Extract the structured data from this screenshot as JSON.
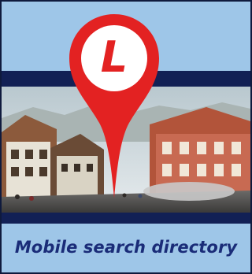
{
  "logo": {
    "letter": "L",
    "pin_color": "#e32222",
    "icon": "map-pin-icon"
  },
  "caption": {
    "text": "Mobile search directory"
  },
  "colors": {
    "sky": "#9ec6e8",
    "band": "#122055",
    "caption_text": "#1a2c78"
  },
  "photo": {
    "subject": "alpine-village-street-image"
  }
}
